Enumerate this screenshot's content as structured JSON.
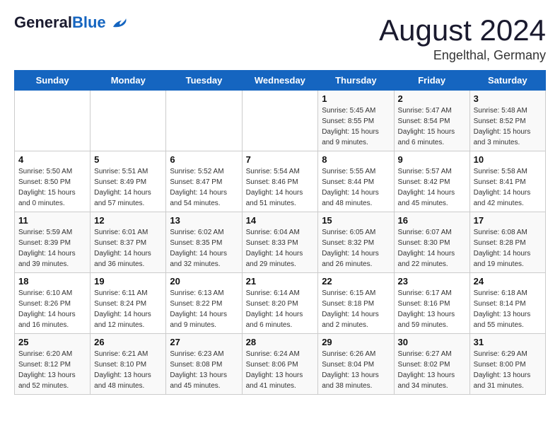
{
  "header": {
    "logo_general": "General",
    "logo_blue": "Blue",
    "month_title": "August 2024",
    "location": "Engelthal, Germany"
  },
  "days_of_week": [
    "Sunday",
    "Monday",
    "Tuesday",
    "Wednesday",
    "Thursday",
    "Friday",
    "Saturday"
  ],
  "weeks": [
    [
      {
        "day": "",
        "info": ""
      },
      {
        "day": "",
        "info": ""
      },
      {
        "day": "",
        "info": ""
      },
      {
        "day": "",
        "info": ""
      },
      {
        "day": "1",
        "info": "Sunrise: 5:45 AM\nSunset: 8:55 PM\nDaylight: 15 hours\nand 9 minutes."
      },
      {
        "day": "2",
        "info": "Sunrise: 5:47 AM\nSunset: 8:54 PM\nDaylight: 15 hours\nand 6 minutes."
      },
      {
        "day": "3",
        "info": "Sunrise: 5:48 AM\nSunset: 8:52 PM\nDaylight: 15 hours\nand 3 minutes."
      }
    ],
    [
      {
        "day": "4",
        "info": "Sunrise: 5:50 AM\nSunset: 8:50 PM\nDaylight: 15 hours\nand 0 minutes."
      },
      {
        "day": "5",
        "info": "Sunrise: 5:51 AM\nSunset: 8:49 PM\nDaylight: 14 hours\nand 57 minutes."
      },
      {
        "day": "6",
        "info": "Sunrise: 5:52 AM\nSunset: 8:47 PM\nDaylight: 14 hours\nand 54 minutes."
      },
      {
        "day": "7",
        "info": "Sunrise: 5:54 AM\nSunset: 8:46 PM\nDaylight: 14 hours\nand 51 minutes."
      },
      {
        "day": "8",
        "info": "Sunrise: 5:55 AM\nSunset: 8:44 PM\nDaylight: 14 hours\nand 48 minutes."
      },
      {
        "day": "9",
        "info": "Sunrise: 5:57 AM\nSunset: 8:42 PM\nDaylight: 14 hours\nand 45 minutes."
      },
      {
        "day": "10",
        "info": "Sunrise: 5:58 AM\nSunset: 8:41 PM\nDaylight: 14 hours\nand 42 minutes."
      }
    ],
    [
      {
        "day": "11",
        "info": "Sunrise: 5:59 AM\nSunset: 8:39 PM\nDaylight: 14 hours\nand 39 minutes."
      },
      {
        "day": "12",
        "info": "Sunrise: 6:01 AM\nSunset: 8:37 PM\nDaylight: 14 hours\nand 36 minutes."
      },
      {
        "day": "13",
        "info": "Sunrise: 6:02 AM\nSunset: 8:35 PM\nDaylight: 14 hours\nand 32 minutes."
      },
      {
        "day": "14",
        "info": "Sunrise: 6:04 AM\nSunset: 8:33 PM\nDaylight: 14 hours\nand 29 minutes."
      },
      {
        "day": "15",
        "info": "Sunrise: 6:05 AM\nSunset: 8:32 PM\nDaylight: 14 hours\nand 26 minutes."
      },
      {
        "day": "16",
        "info": "Sunrise: 6:07 AM\nSunset: 8:30 PM\nDaylight: 14 hours\nand 22 minutes."
      },
      {
        "day": "17",
        "info": "Sunrise: 6:08 AM\nSunset: 8:28 PM\nDaylight: 14 hours\nand 19 minutes."
      }
    ],
    [
      {
        "day": "18",
        "info": "Sunrise: 6:10 AM\nSunset: 8:26 PM\nDaylight: 14 hours\nand 16 minutes."
      },
      {
        "day": "19",
        "info": "Sunrise: 6:11 AM\nSunset: 8:24 PM\nDaylight: 14 hours\nand 12 minutes."
      },
      {
        "day": "20",
        "info": "Sunrise: 6:13 AM\nSunset: 8:22 PM\nDaylight: 14 hours\nand 9 minutes."
      },
      {
        "day": "21",
        "info": "Sunrise: 6:14 AM\nSunset: 8:20 PM\nDaylight: 14 hours\nand 6 minutes."
      },
      {
        "day": "22",
        "info": "Sunrise: 6:15 AM\nSunset: 8:18 PM\nDaylight: 14 hours\nand 2 minutes."
      },
      {
        "day": "23",
        "info": "Sunrise: 6:17 AM\nSunset: 8:16 PM\nDaylight: 13 hours\nand 59 minutes."
      },
      {
        "day": "24",
        "info": "Sunrise: 6:18 AM\nSunset: 8:14 PM\nDaylight: 13 hours\nand 55 minutes."
      }
    ],
    [
      {
        "day": "25",
        "info": "Sunrise: 6:20 AM\nSunset: 8:12 PM\nDaylight: 13 hours\nand 52 minutes."
      },
      {
        "day": "26",
        "info": "Sunrise: 6:21 AM\nSunset: 8:10 PM\nDaylight: 13 hours\nand 48 minutes."
      },
      {
        "day": "27",
        "info": "Sunrise: 6:23 AM\nSunset: 8:08 PM\nDaylight: 13 hours\nand 45 minutes."
      },
      {
        "day": "28",
        "info": "Sunrise: 6:24 AM\nSunset: 8:06 PM\nDaylight: 13 hours\nand 41 minutes."
      },
      {
        "day": "29",
        "info": "Sunrise: 6:26 AM\nSunset: 8:04 PM\nDaylight: 13 hours\nand 38 minutes."
      },
      {
        "day": "30",
        "info": "Sunrise: 6:27 AM\nSunset: 8:02 PM\nDaylight: 13 hours\nand 34 minutes."
      },
      {
        "day": "31",
        "info": "Sunrise: 6:29 AM\nSunset: 8:00 PM\nDaylight: 13 hours\nand 31 minutes."
      }
    ]
  ]
}
